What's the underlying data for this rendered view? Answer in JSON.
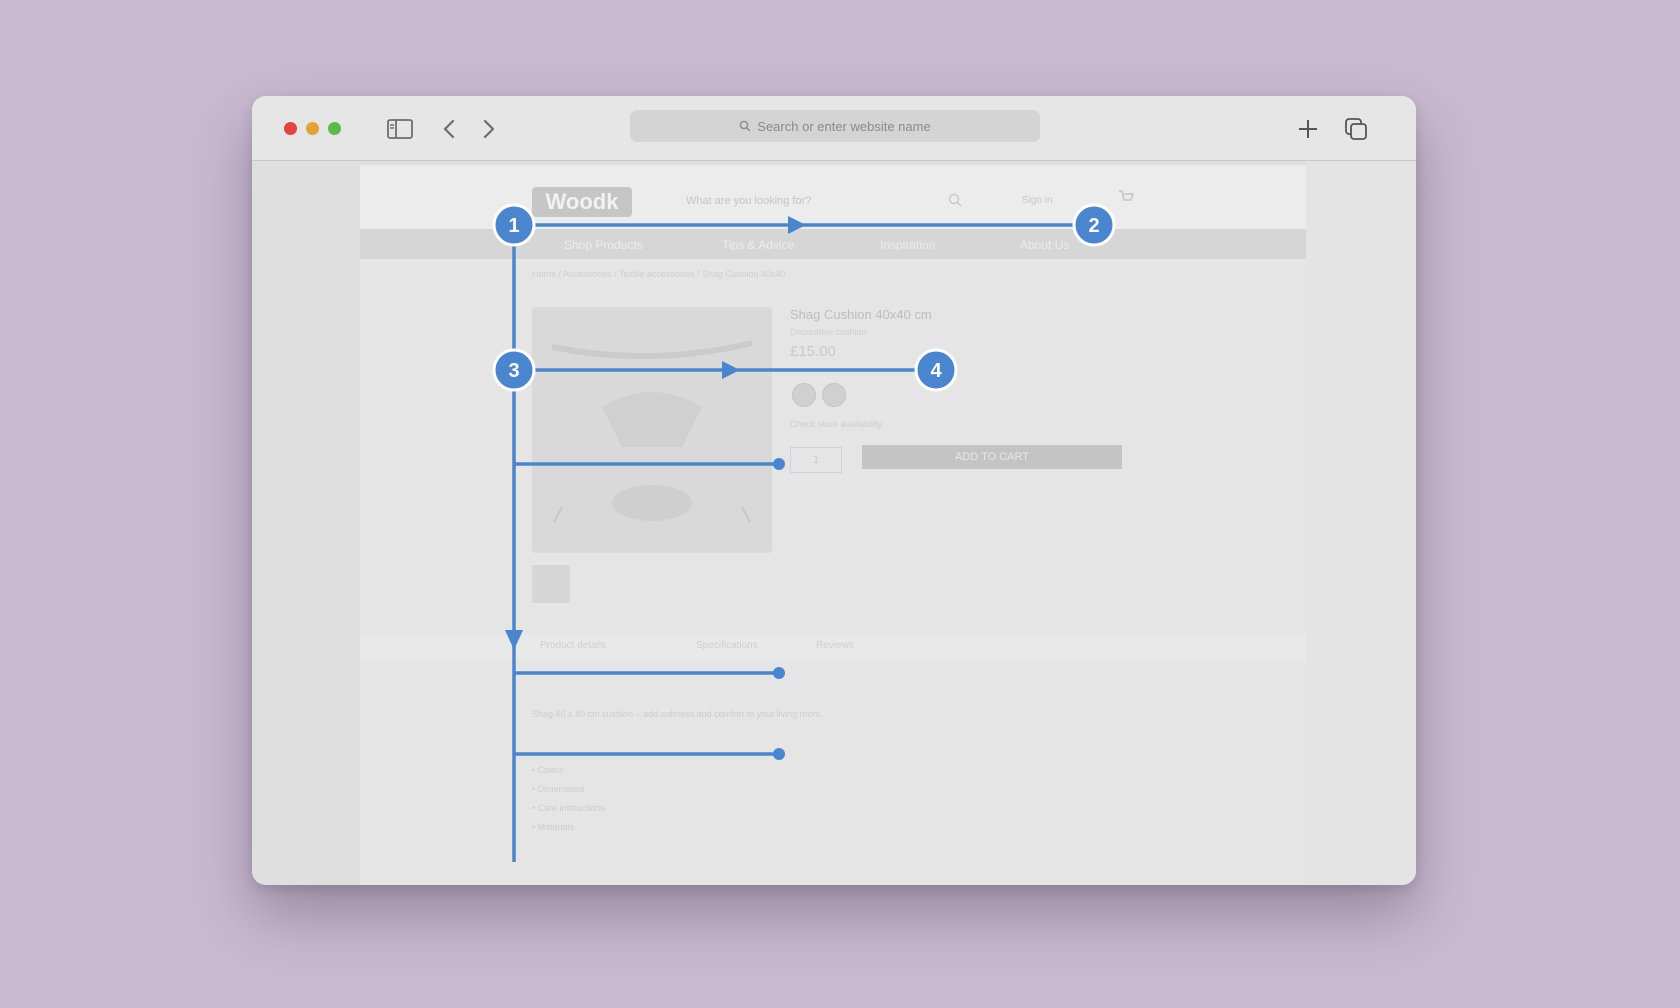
{
  "browser": {
    "address_placeholder": "Search or enter website name"
  },
  "site": {
    "logo_text": "Woodk",
    "search_placeholder": "What are you looking for?",
    "account_label": "Sign in",
    "nav": [
      "Shop Products",
      "Tips & Advice",
      "Inspiration",
      "About Us"
    ],
    "breadcrumb": "Home / Accessories / Textile accessories / Shag Cushion 40x40",
    "product": {
      "title": "Shag Cushion 40x40 cm",
      "subtitle": "Decorative cushion",
      "price": "£15.00",
      "stock_note": "Check store availability",
      "qty": "1",
      "add_to_cart": "ADD TO CART"
    },
    "tabs": [
      "Product details",
      "Specifications",
      "Reviews"
    ],
    "description": "Shag 40 x 40 cm cushion – add softness and comfort to your living room.",
    "list_items": [
      "Colour",
      "Dimensions",
      "Care instructions",
      "Materials"
    ]
  },
  "flow": {
    "markers": [
      "1",
      "2",
      "3",
      "4"
    ],
    "color": "#4a86cf"
  },
  "colors": {
    "background": "#c9bad1",
    "traffic_red": "#e2453c",
    "traffic_yellow": "#e4a232",
    "traffic_green": "#5cb946"
  }
}
